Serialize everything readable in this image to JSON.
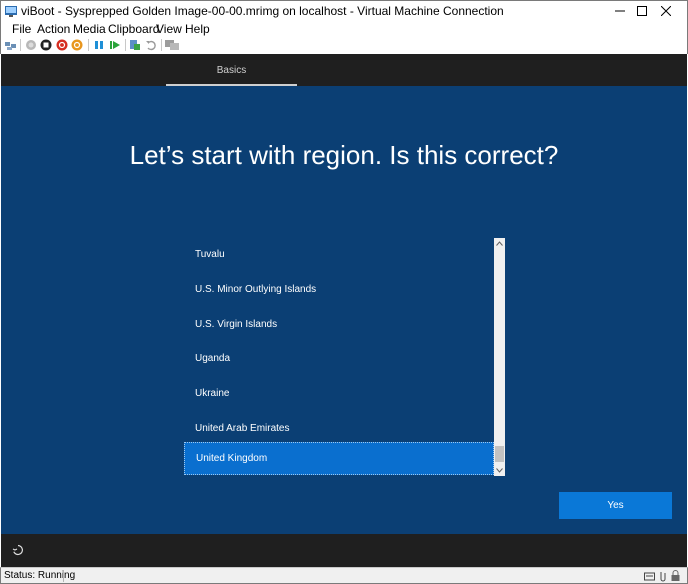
{
  "window": {
    "title": "viBoot - Sysprepped Golden Image-00-00.mrimg on localhost - Virtual Machine Connection",
    "icon": "viboot-app-icon"
  },
  "menu": {
    "items": [
      {
        "label": "File"
      },
      {
        "label": "Action"
      },
      {
        "label": "Media"
      },
      {
        "label": "Clipboard"
      },
      {
        "label": "View"
      },
      {
        "label": "Help"
      }
    ]
  },
  "toolbar": {
    "buttons": [
      "ctrl-alt-del-icon",
      "start-icon",
      "turn-off-icon",
      "shut-down-icon",
      "save-state-icon",
      "pause-icon",
      "resume-icon",
      "checkpoint-icon",
      "revert-icon",
      "enhanced-session-icon"
    ]
  },
  "vm": {
    "tab": "Basics",
    "heading": "Let’s start with region. Is this correct?",
    "regions": [
      "Tuvalu",
      "U.S. Minor Outlying Islands",
      "U.S. Virgin Islands",
      "Uganda",
      "Ukraine",
      "United Arab Emirates",
      "United Kingdom"
    ],
    "selected_region": "United Kingdom",
    "yes_label": "Yes",
    "colors": {
      "background": "#0b3f74",
      "selection": "#0a6fcf",
      "button": "#0a78d7",
      "bars": "#1f1f1f"
    }
  },
  "status": {
    "text": "Status: Running"
  }
}
